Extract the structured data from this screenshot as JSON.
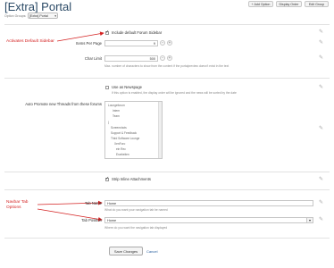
{
  "header": {
    "title": "[Extra] Portal",
    "buttons": [
      "+ Add Option",
      "Display Order",
      "Edit Group"
    ],
    "option_groups_label": "Option Groups:",
    "option_group_selected": "[Extra] Portal"
  },
  "fields": {
    "include_sidebar": "Include default Forum Sidebar",
    "items_per_page_label": "Items Per Page",
    "items_per_page_value": "9",
    "char_limit_label": "Char Limit",
    "char_limit_value": "500",
    "char_limit_hint": "Max. number of characters to show from the content if the portalpreview doesn't exist in the text",
    "use_as_newspage": "Use as Newspage",
    "use_as_newspage_hint": "If this option is enabled, the display order will be ignored and the news will be sorted by the date",
    "auto_promote_label": "Auto Promote new Threads from these forums",
    "forum_options": [
      "Loungeforum",
      "Intern",
      "Team",
      "(",
      "Screenshots",
      "Support & Feedback",
      "Third Software Lounge",
      "XenForo",
      "ein Rec",
      "Erarbeiten"
    ],
    "strip_inline": "Strip Inline Attachments",
    "tab_name_label": "Tab Name",
    "tab_name_value": "Home",
    "tab_name_hint": "What do you want your navigation tab be named",
    "tab_position_label": "Tab Position",
    "tab_position_value": "Home",
    "tab_position_hint": "Where do you want the navigation tab displayed"
  },
  "annotations": {
    "activates_sidebar": "Activates Default Sidebar",
    "navbar_tab_line1": "Navbar Tab",
    "navbar_tab_line2": "Options"
  },
  "footer": {
    "save": "Save Changes",
    "cancel": "Cancel"
  },
  "colors": {
    "title": "#2b4a66",
    "annotation": "#d42323"
  }
}
